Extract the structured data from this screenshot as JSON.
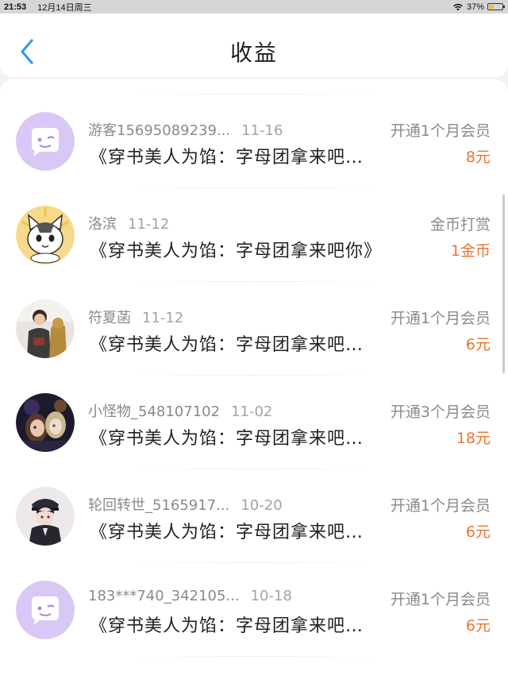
{
  "status_bar": {
    "time": "21:53",
    "date": "12月14日周三",
    "battery_pct": "37%",
    "battery_level": 0.37
  },
  "header": {
    "title": "收益",
    "back_icon": "chevron-left-icon",
    "accent_color": "#2a9df4"
  },
  "records": [
    {
      "user": "游客15695089239...",
      "date": "11-16",
      "type": "开通1个月会员",
      "book": "《穿书美人为馅：字母团拿来吧…",
      "amount": "8元",
      "avatar": "purple-chat-bubble"
    },
    {
      "user": "洛滨",
      "date": "11-12",
      "type": "金币打赏",
      "book": "《穿书美人为馅：字母团拿来吧你》",
      "amount": "1金币",
      "avatar": "cartoon-cat"
    },
    {
      "user": "符夏菡",
      "date": "11-12",
      "type": "开通1个月会员",
      "book": "《穿书美人为馅：字母团拿来吧…",
      "amount": "6元",
      "avatar": "photo-person"
    },
    {
      "user": "小怪物_548107102",
      "date": "11-02",
      "type": "开通3个月会员",
      "book": "《穿书美人为馅：字母团拿来吧…",
      "amount": "18元",
      "avatar": "anime-dark"
    },
    {
      "user": "轮回转世_5165917...",
      "date": "10-20",
      "type": "开通1个月会员",
      "book": "《穿书美人为馅：字母团拿来吧…",
      "amount": "6元",
      "avatar": "anime-uniform"
    },
    {
      "user": "183***740_342105...",
      "date": "10-18",
      "type": "开通1个月会员",
      "book": "《穿书美人为馅：字母团拿来吧…",
      "amount": "6元",
      "avatar": "purple-chat-bubble"
    }
  ],
  "colors": {
    "amount": "#e8762d",
    "muted_text": "#8a8a8a",
    "avatar_purple": "#d9c8f5"
  }
}
